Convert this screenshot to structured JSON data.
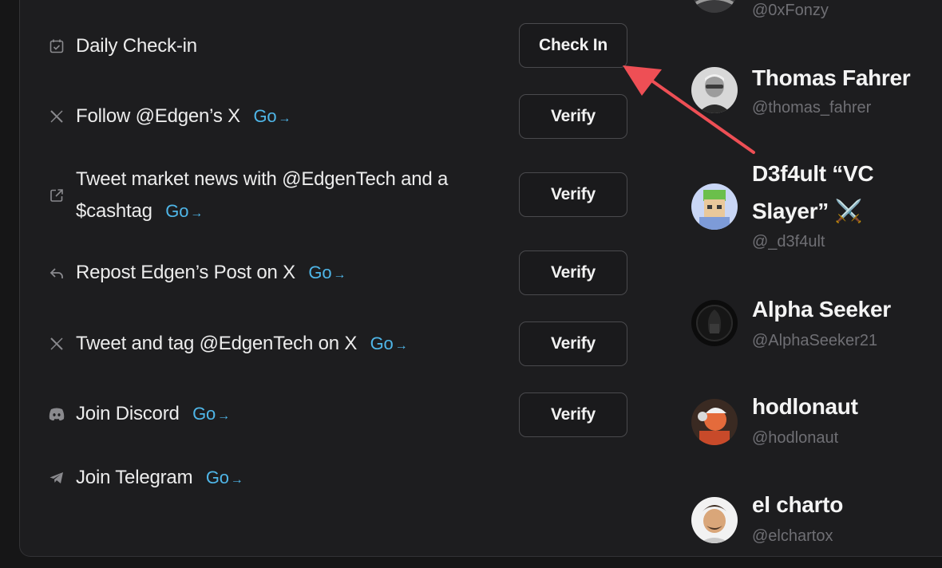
{
  "tasks": [
    {
      "icon": "calendar-check-icon",
      "text": "Daily Check-in",
      "go": "",
      "button": "Check In"
    },
    {
      "icon": "x-logo-icon",
      "text": "Follow @Edgen’s X",
      "go": "Go",
      "button": "Verify"
    },
    {
      "icon": "external-link-icon",
      "text_line1": "Tweet market news with @EdgenTech and a",
      "text_line2": "$cashtag",
      "go": "Go",
      "button": "Verify"
    },
    {
      "icon": "repost-icon",
      "text": "Repost Edgen’s Post on X",
      "go": "Go",
      "button": "Verify"
    },
    {
      "icon": "x-logo-icon",
      "text": "Tweet and tag @EdgenTech on X",
      "go": "Go",
      "button": "Verify"
    },
    {
      "icon": "discord-icon",
      "text": "Join Discord",
      "go": "Go",
      "button": "Verify"
    },
    {
      "icon": "telegram-icon",
      "text": "Join Telegram",
      "go": "Go"
    }
  ],
  "go_arrow": "→",
  "users": [
    {
      "name": "",
      "handle": "@0xFonzy"
    },
    {
      "name": "Thomas Fahrer",
      "handle": "@thomas_fahrer"
    },
    {
      "name_line1": "D3f4ult “VC",
      "name_line2": "Slayer” ⚔️",
      "handle": "@_d3f4ult"
    },
    {
      "name": "Alpha Seeker",
      "handle": "@AlphaSeeker21"
    },
    {
      "name": "hodlonaut",
      "handle": "@hodlonaut"
    },
    {
      "name": "el charto",
      "handle": "@elchartox"
    }
  ],
  "colors": {
    "background": "#1d1d1f",
    "text": "#ececec",
    "muted": "#6f6f74",
    "link": "#4fb6e8",
    "annotation_arrow": "#ee4f55"
  }
}
